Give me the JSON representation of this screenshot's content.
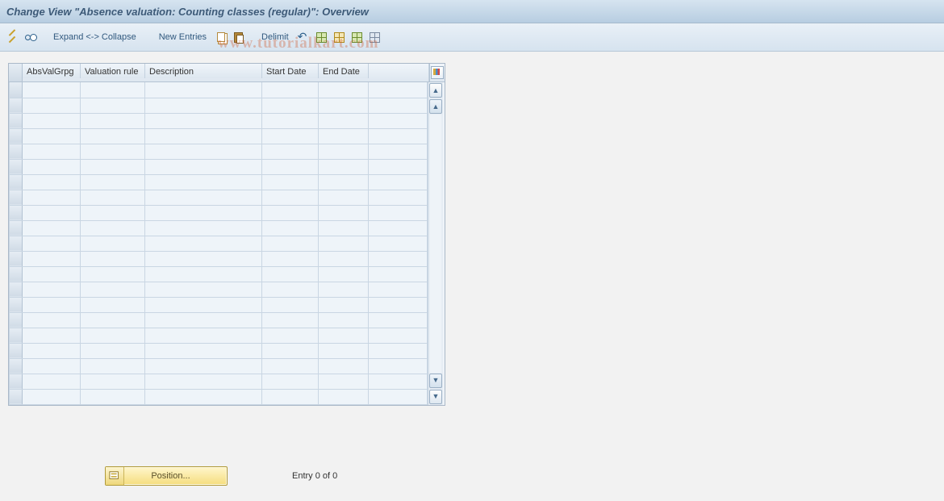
{
  "title": "Change View \"Absence valuation: Counting classes (regular)\": Overview",
  "toolbar": {
    "expand_collapse": "Expand <-> Collapse",
    "new_entries": "New Entries",
    "delimit": "Delimit"
  },
  "grid": {
    "columns": {
      "col1": "AbsValGrpg",
      "col2": "Valuation rule",
      "col3": "Description",
      "col4": "Start Date",
      "col5": "End Date"
    },
    "rows": [
      {
        "absvalgrpg": "",
        "valuationrule": "",
        "description": "",
        "startdate": "",
        "enddate": ""
      },
      {
        "absvalgrpg": "",
        "valuationrule": "",
        "description": "",
        "startdate": "",
        "enddate": ""
      },
      {
        "absvalgrpg": "",
        "valuationrule": "",
        "description": "",
        "startdate": "",
        "enddate": ""
      },
      {
        "absvalgrpg": "",
        "valuationrule": "",
        "description": "",
        "startdate": "",
        "enddate": ""
      },
      {
        "absvalgrpg": "",
        "valuationrule": "",
        "description": "",
        "startdate": "",
        "enddate": ""
      },
      {
        "absvalgrpg": "",
        "valuationrule": "",
        "description": "",
        "startdate": "",
        "enddate": ""
      },
      {
        "absvalgrpg": "",
        "valuationrule": "",
        "description": "",
        "startdate": "",
        "enddate": ""
      },
      {
        "absvalgrpg": "",
        "valuationrule": "",
        "description": "",
        "startdate": "",
        "enddate": ""
      },
      {
        "absvalgrpg": "",
        "valuationrule": "",
        "description": "",
        "startdate": "",
        "enddate": ""
      },
      {
        "absvalgrpg": "",
        "valuationrule": "",
        "description": "",
        "startdate": "",
        "enddate": ""
      },
      {
        "absvalgrpg": "",
        "valuationrule": "",
        "description": "",
        "startdate": "",
        "enddate": ""
      },
      {
        "absvalgrpg": "",
        "valuationrule": "",
        "description": "",
        "startdate": "",
        "enddate": ""
      },
      {
        "absvalgrpg": "",
        "valuationrule": "",
        "description": "",
        "startdate": "",
        "enddate": ""
      },
      {
        "absvalgrpg": "",
        "valuationrule": "",
        "description": "",
        "startdate": "",
        "enddate": ""
      },
      {
        "absvalgrpg": "",
        "valuationrule": "",
        "description": "",
        "startdate": "",
        "enddate": ""
      },
      {
        "absvalgrpg": "",
        "valuationrule": "",
        "description": "",
        "startdate": "",
        "enddate": ""
      },
      {
        "absvalgrpg": "",
        "valuationrule": "",
        "description": "",
        "startdate": "",
        "enddate": ""
      },
      {
        "absvalgrpg": "",
        "valuationrule": "",
        "description": "",
        "startdate": "",
        "enddate": ""
      },
      {
        "absvalgrpg": "",
        "valuationrule": "",
        "description": "",
        "startdate": "",
        "enddate": ""
      },
      {
        "absvalgrpg": "",
        "valuationrule": "",
        "description": "",
        "startdate": "",
        "enddate": ""
      },
      {
        "absvalgrpg": "",
        "valuationrule": "",
        "description": "",
        "startdate": "",
        "enddate": ""
      }
    ]
  },
  "footer": {
    "position_label": "Position...",
    "entry_text": "Entry 0 of 0"
  },
  "watermark": "www.tutorialkart.com"
}
